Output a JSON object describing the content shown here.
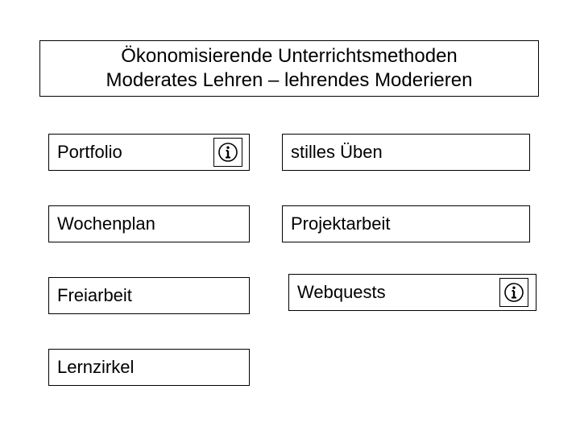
{
  "title": {
    "line1": "Ökonomisierende Unterrichtsmethoden",
    "line2": "Moderates Lehren – lehrendes Moderieren"
  },
  "left": {
    "item1": "Portfolio",
    "item2": "Wochenplan",
    "item3": "Freiarbeit",
    "item4": "Lernzirkel"
  },
  "right": {
    "item1": "stilles Üben",
    "item2": "Projektarbeit",
    "item3": "Webquests"
  },
  "icons": {
    "info": "info-icon"
  }
}
